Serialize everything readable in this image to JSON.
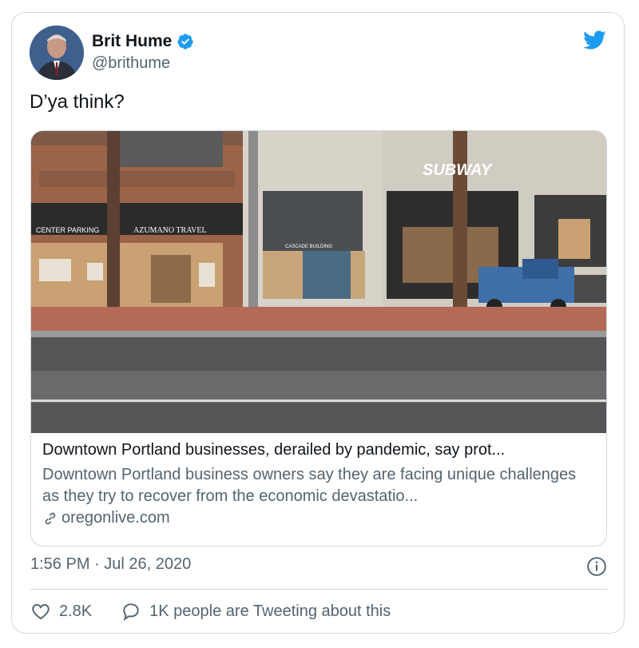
{
  "author": {
    "name": "Brit Hume",
    "handle": "@brithume",
    "verified": true
  },
  "tweet": {
    "text": "D’ya think?",
    "timestamp": "1:56 PM · Jul 26, 2020"
  },
  "link_card": {
    "title": "Downtown Portland businesses, derailed by pandemic, say prot...",
    "description": "Downtown Portland business owners say they are facing unique challenges as they try to recover from the economic devastatio...",
    "domain": "oregonlive.com",
    "image_signs": {
      "parking": "CENTER PARKING",
      "travel": "AZUMANO TRAVEL",
      "building": "CASCADE BUILDING",
      "subway": "SUBWAY"
    }
  },
  "actions": {
    "likes": "2.8K",
    "conversation": "1K people are Tweeting about this"
  },
  "colors": {
    "twitter_blue": "#1d9bf0",
    "secondary_text": "#536471",
    "border": "#cfd9de"
  },
  "icons": [
    "verified-badge-icon",
    "twitter-bird-icon",
    "link-icon",
    "info-icon",
    "heart-icon",
    "comment-bubble-icon"
  ]
}
